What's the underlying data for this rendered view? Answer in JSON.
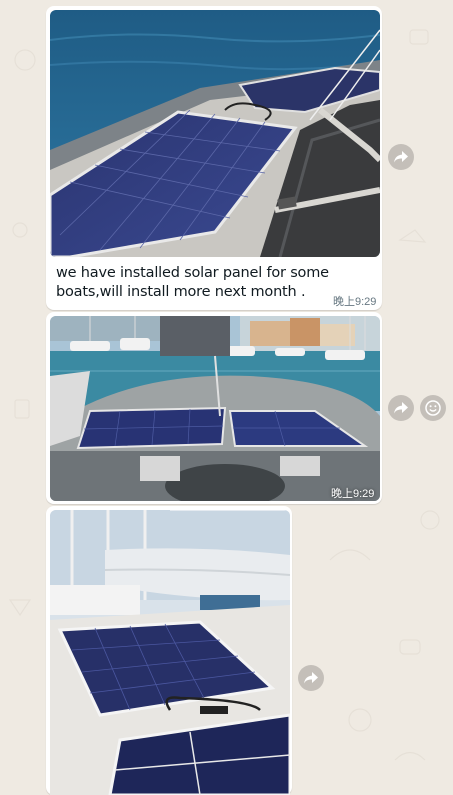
{
  "messages": [
    {
      "type": "image_with_caption",
      "image_icon": "boat-solar-panel-photo",
      "caption": "we have installed solar panel for some boats,will install more next month .",
      "time": "晚上9:29"
    },
    {
      "type": "image",
      "image_icon": "marina-boat-solar-photo",
      "time": "晚上9:29"
    },
    {
      "type": "image",
      "image_icon": "sailboat-deck-solar-photo"
    }
  ],
  "actions": {
    "forward_icon": "forward-arrow-icon",
    "react_icon": "emoji-smiley-icon"
  },
  "colors": {
    "chat_background": "#efeae2",
    "bubble": "#ffffff",
    "time_text": "#667781",
    "message_text": "#111b21"
  }
}
